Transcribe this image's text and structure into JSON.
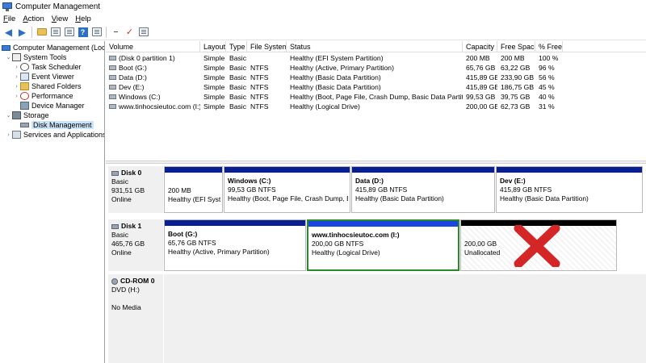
{
  "window": {
    "title": "Computer Management"
  },
  "menu": [
    {
      "label": "File",
      "accel": "F",
      "rest": "ile"
    },
    {
      "label": "Action",
      "accel": "A",
      "rest": "ction"
    },
    {
      "label": "View",
      "accel": "V",
      "rest": "iew"
    },
    {
      "label": "Help",
      "accel": "H",
      "rest": "elp"
    }
  ],
  "toolbar": [
    "back-arrow-icon",
    "forward-arrow-icon",
    "up-folder-icon",
    "show-hide-tree-icon",
    "help-icon",
    "properties-icon",
    "connect-icon",
    "check-icon",
    "list-view-icon"
  ],
  "tree": {
    "root": "Computer Management (Local",
    "items": [
      {
        "label": "System Tools",
        "icon": "tools-icon"
      },
      {
        "label": "Task Scheduler",
        "icon": "clock-icon"
      },
      {
        "label": "Event Viewer",
        "icon": "event-viewer-icon"
      },
      {
        "label": "Shared Folders",
        "icon": "shared-folder-icon"
      },
      {
        "label": "Performance",
        "icon": "performance-icon"
      },
      {
        "label": "Device Manager",
        "icon": "device-manager-icon"
      },
      {
        "label": "Storage",
        "icon": "storage-icon"
      },
      {
        "label": "Disk Management",
        "icon": "disk-icon"
      },
      {
        "label": "Services and Applications",
        "icon": "services-icon"
      }
    ]
  },
  "volume_table": {
    "columns": [
      "Volume",
      "Layout",
      "Type",
      "File System",
      "Status",
      "Capacity",
      "Free Space",
      "% Free"
    ],
    "rows": [
      [
        "(Disk 0 partition 1)",
        "Simple",
        "Basic",
        "",
        "Healthy (EFI System Partition)",
        "200 MB",
        "200 MB",
        "100 %"
      ],
      [
        "Boot (G:)",
        "Simple",
        "Basic",
        "NTFS",
        "Healthy (Active, Primary Partition)",
        "65,76 GB",
        "63,22 GB",
        "96 %"
      ],
      [
        "Data (D:)",
        "Simple",
        "Basic",
        "NTFS",
        "Healthy (Basic Data Partition)",
        "415,89 GB",
        "233,90 GB",
        "56 %"
      ],
      [
        "Dev (E:)",
        "Simple",
        "Basic",
        "NTFS",
        "Healthy (Basic Data Partition)",
        "415,89 GB",
        "186,75 GB",
        "45 %"
      ],
      [
        "Windows (C:)",
        "Simple",
        "Basic",
        "NTFS",
        "Healthy (Boot, Page File, Crash Dump, Basic Data Partition)",
        "99,53 GB",
        "39,75 GB",
        "40 %"
      ],
      [
        "www.tinhocsieutoc.com (I:)",
        "Simple",
        "Basic",
        "NTFS",
        "Healthy (Logical Drive)",
        "200,00 GB",
        "62,73 GB",
        "31 %"
      ]
    ]
  },
  "disks": [
    {
      "name": "Disk 0",
      "type": "Basic",
      "size": "931,51 GB",
      "status": "Online",
      "partitions": [
        {
          "name": "",
          "size": "200 MB",
          "status": "Healthy (EFI Syste"
        },
        {
          "name": "Windows  (C:)",
          "size": "99,53 GB NTFS",
          "status": "Healthy (Boot, Page File, Crash Dump, Ba"
        },
        {
          "name": "Data  (D:)",
          "size": "415,89 GB NTFS",
          "status": "Healthy (Basic Data Partition)"
        },
        {
          "name": "Dev  (E:)",
          "size": "415,89 GB NTFS",
          "status": "Healthy (Basic Data Partition)"
        }
      ]
    },
    {
      "name": "Disk 1",
      "type": "Basic",
      "size": "465,76 GB",
      "status": "Online",
      "partitions": [
        {
          "name": "Boot  (G:)",
          "size": "65,76 GB NTFS",
          "status": "Healthy (Active, Primary Partition)"
        },
        {
          "name": "www.tinhocsieutoc.com  (I:)",
          "size": "200,00 GB NTFS",
          "status": "Healthy (Logical Drive)"
        },
        {
          "name": "",
          "size": "200,00 GB",
          "status": "Unallocated"
        }
      ]
    },
    {
      "name": "CD-ROM 0",
      "type": "DVD (H:)",
      "size": "",
      "status": "No Media"
    }
  ],
  "colors": {
    "primary_partition_bar": "#0a1f8f",
    "logical_drive_bar": "#1a45e0",
    "unallocated_bar": "#000000",
    "selection_border": "#2a8a2a",
    "red_x": "#d42626"
  }
}
